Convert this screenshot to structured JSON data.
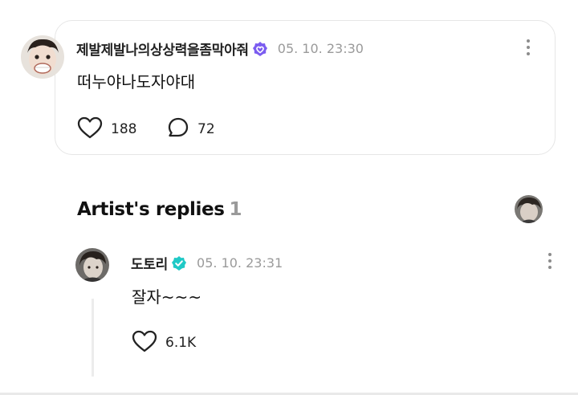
{
  "post": {
    "username": "제발제발나의상상력을좀막아줘",
    "timestamp": "05. 10. 23:30",
    "content": "떠누야나도자야대",
    "likes": "188",
    "comments": "72"
  },
  "artist_replies": {
    "title": "Artist's replies",
    "count": "1"
  },
  "reply": {
    "username": "도토리",
    "timestamp": "05. 10. 23:31",
    "content": "잘자~~~",
    "likes": "6.1K"
  },
  "colors": {
    "fan_badge": "#7b5cf0",
    "artist_badge": "#1fc9c6",
    "muted_text": "#9a9a9a"
  },
  "icons": [
    "verified-badge-icon",
    "heart-icon",
    "comment-icon",
    "more-vertical-icon"
  ]
}
